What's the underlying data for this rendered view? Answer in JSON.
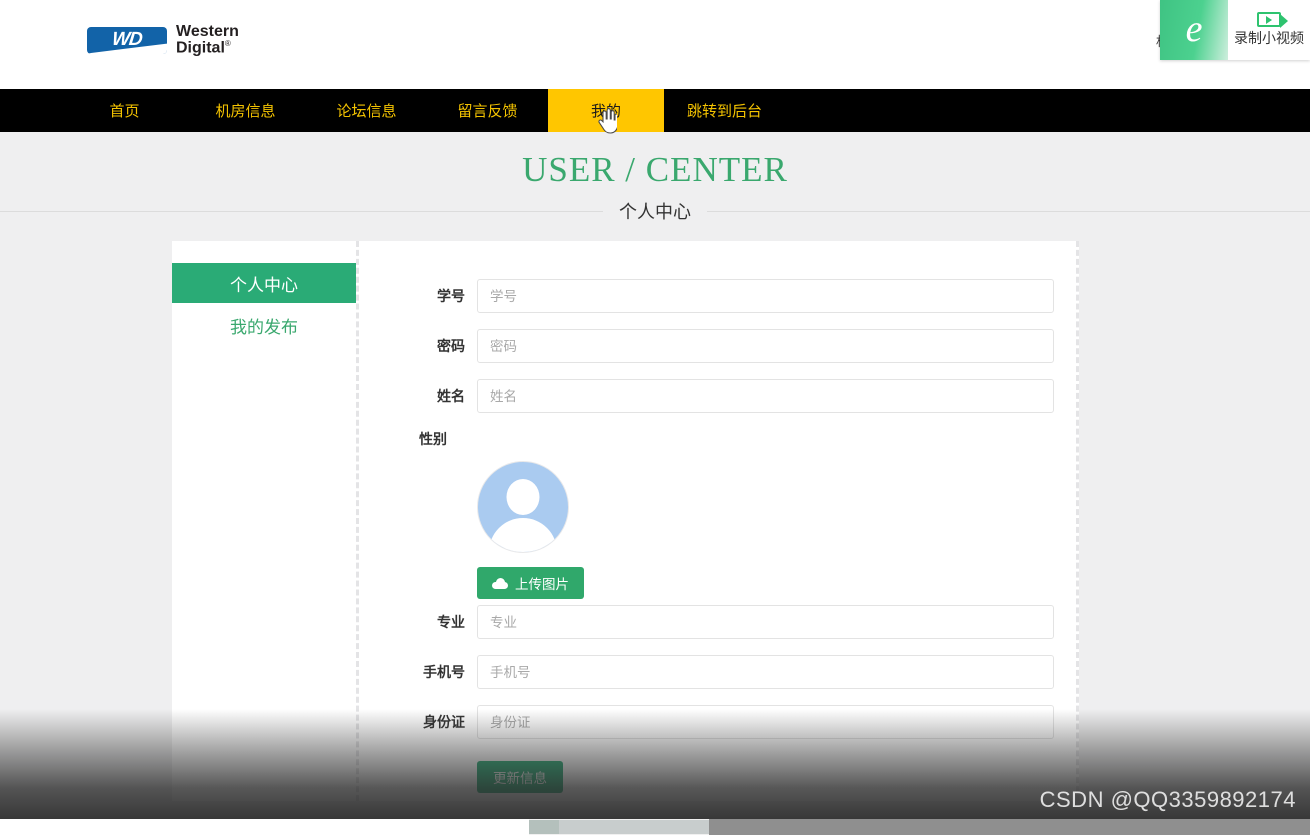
{
  "header": {
    "logo": {
      "badge_text": "WD",
      "brand_line1": "Western",
      "brand_line2": "Digital",
      "registered_mark": "®"
    },
    "right_text": "机房"
  },
  "record_overlay": {
    "browser_icon": "internet-explorer-icon",
    "camera_icon": "video-camera-icon",
    "label": "录制小视频"
  },
  "nav": {
    "items": [
      {
        "label": "首页",
        "active": false
      },
      {
        "label": "机房信息",
        "active": false
      },
      {
        "label": "论坛信息",
        "active": false
      },
      {
        "label": "留言反馈",
        "active": false
      },
      {
        "label": "我的",
        "active": true
      },
      {
        "label": "跳转到后台",
        "active": false
      }
    ]
  },
  "page_title": {
    "english": "USER / CENTER",
    "chinese": "个人中心"
  },
  "sidebar": {
    "items": [
      {
        "label": "个人中心",
        "active": true
      },
      {
        "label": "我的发布",
        "active": false
      }
    ]
  },
  "form": {
    "fields": [
      {
        "label": "学号",
        "placeholder": "学号",
        "value": "",
        "type": "text"
      },
      {
        "label": "密码",
        "placeholder": "密码",
        "value": "",
        "type": "password"
      },
      {
        "label": "姓名",
        "placeholder": "姓名",
        "value": "",
        "type": "text"
      }
    ],
    "gender_label": "性别",
    "avatar": {
      "icon": "default-user-avatar",
      "upload_label": "上传图片",
      "upload_icon": "cloud-upload-icon"
    },
    "fields_bottom": [
      {
        "label": "专业",
        "placeholder": "专业",
        "value": "",
        "type": "text"
      },
      {
        "label": "手机号",
        "placeholder": "手机号",
        "value": "",
        "type": "text"
      },
      {
        "label": "身份证",
        "placeholder": "身份证",
        "value": "",
        "type": "text"
      }
    ],
    "submit_label": "更新信息"
  },
  "watermark": "CSDN @QQ3359892174",
  "colors": {
    "nav_bg": "#000000",
    "nav_text": "#f4c300",
    "nav_active_bg": "#ffc600",
    "brand_green": "#2aab76",
    "title_green": "#3aa86e",
    "page_bg": "#efeff0",
    "wd_blue": "#1263a8"
  }
}
